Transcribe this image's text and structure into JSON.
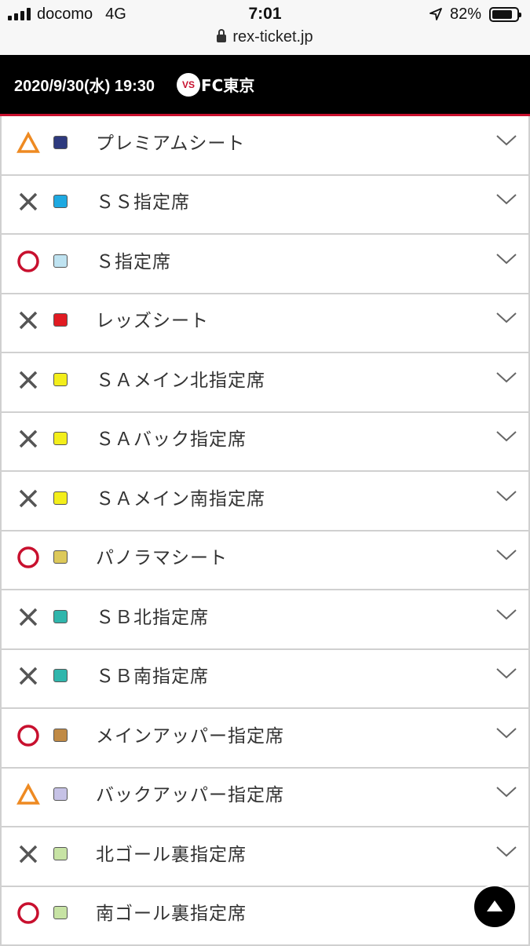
{
  "status_bar": {
    "carrier": "docomo",
    "network": "4G",
    "time": "7:01",
    "battery": "82%",
    "battery_level": 0.82
  },
  "url_bar": {
    "url": "rex-ticket.jp",
    "icon": "lock-icon"
  },
  "match": {
    "date": "2020/9/30(水) 19:30",
    "vs": "VS",
    "opponent": "FC東京",
    "accent_color": "#c8102e"
  },
  "legend_icons": {
    "available": "circle-icon",
    "few_left": "triangle-icon",
    "sold_out": "cross-icon"
  },
  "seats": [
    {
      "name": "プレミアムシート",
      "availability": "few",
      "color": "#2e3a7e"
    },
    {
      "name": "ＳＳ指定席",
      "availability": "soldout",
      "color": "#1ea9e1"
    },
    {
      "name": "Ｓ指定席",
      "availability": "available",
      "color": "#bfe3f1"
    },
    {
      "name": "レッズシート",
      "availability": "soldout",
      "color": "#e11b22"
    },
    {
      "name": "ＳＡメイン北指定席",
      "availability": "soldout",
      "color": "#f3ee1b"
    },
    {
      "name": "ＳＡバック指定席",
      "availability": "soldout",
      "color": "#f3ee1b"
    },
    {
      "name": "ＳＡメイン南指定席",
      "availability": "soldout",
      "color": "#f3ee1b"
    },
    {
      "name": "パノラマシート",
      "availability": "available",
      "color": "#ddc95a"
    },
    {
      "name": "ＳＢ北指定席",
      "availability": "soldout",
      "color": "#30b6ac"
    },
    {
      "name": "ＳＢ南指定席",
      "availability": "soldout",
      "color": "#30b6ac"
    },
    {
      "name": "メインアッパー指定席",
      "availability": "available",
      "color": "#c08a45"
    },
    {
      "name": "バックアッパー指定席",
      "availability": "few",
      "color": "#c6c2e6"
    },
    {
      "name": "北ゴール裏指定席",
      "availability": "soldout",
      "color": "#c7e3a4"
    },
    {
      "name": "南ゴール裏指定席",
      "availability": "available",
      "color": "#c7e3a4"
    }
  ],
  "availability_colors": {
    "available": "#c8102e",
    "few": "#ee8a22",
    "soldout": "#555555"
  },
  "scroll_top_icon": "arrow-up-icon"
}
